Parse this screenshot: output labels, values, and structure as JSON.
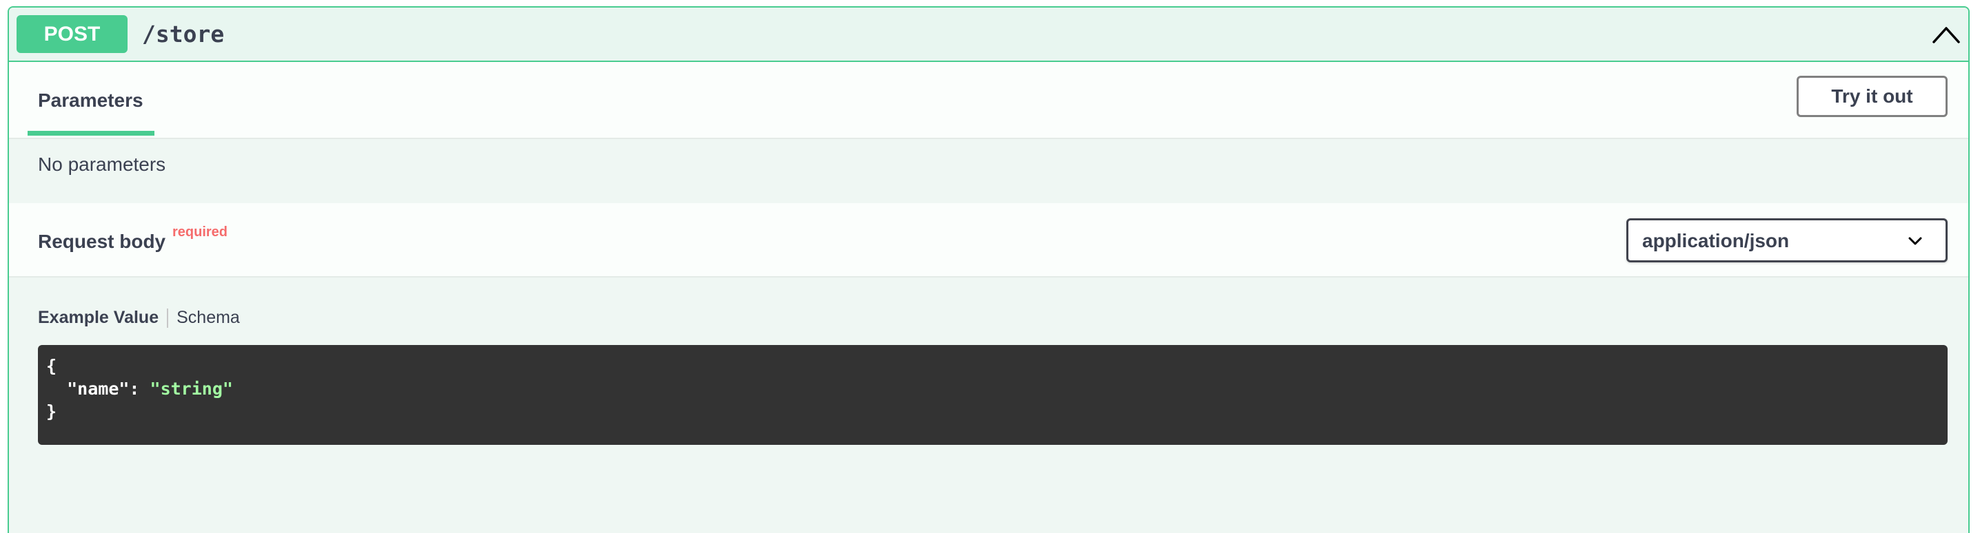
{
  "operation": {
    "method": "POST",
    "path": "/store",
    "colors": {
      "accent": "#49cc90",
      "background": "#eff7f3"
    }
  },
  "icons": {
    "collapse": "chevron-up-icon",
    "select": "chevron-down-icon"
  },
  "tabs": {
    "parameters_label": "Parameters"
  },
  "actions": {
    "try_label": "Try it out"
  },
  "parameters": {
    "empty_text": "No parameters"
  },
  "request_body": {
    "title": "Request body",
    "required_label": "required",
    "content_type": "application/json"
  },
  "example": {
    "value_tab": "Example Value",
    "schema_tab": "Schema",
    "open_brace": "{",
    "key": "\"name\"",
    "colon": ": ",
    "value": "\"string\"",
    "close_brace": "}"
  }
}
